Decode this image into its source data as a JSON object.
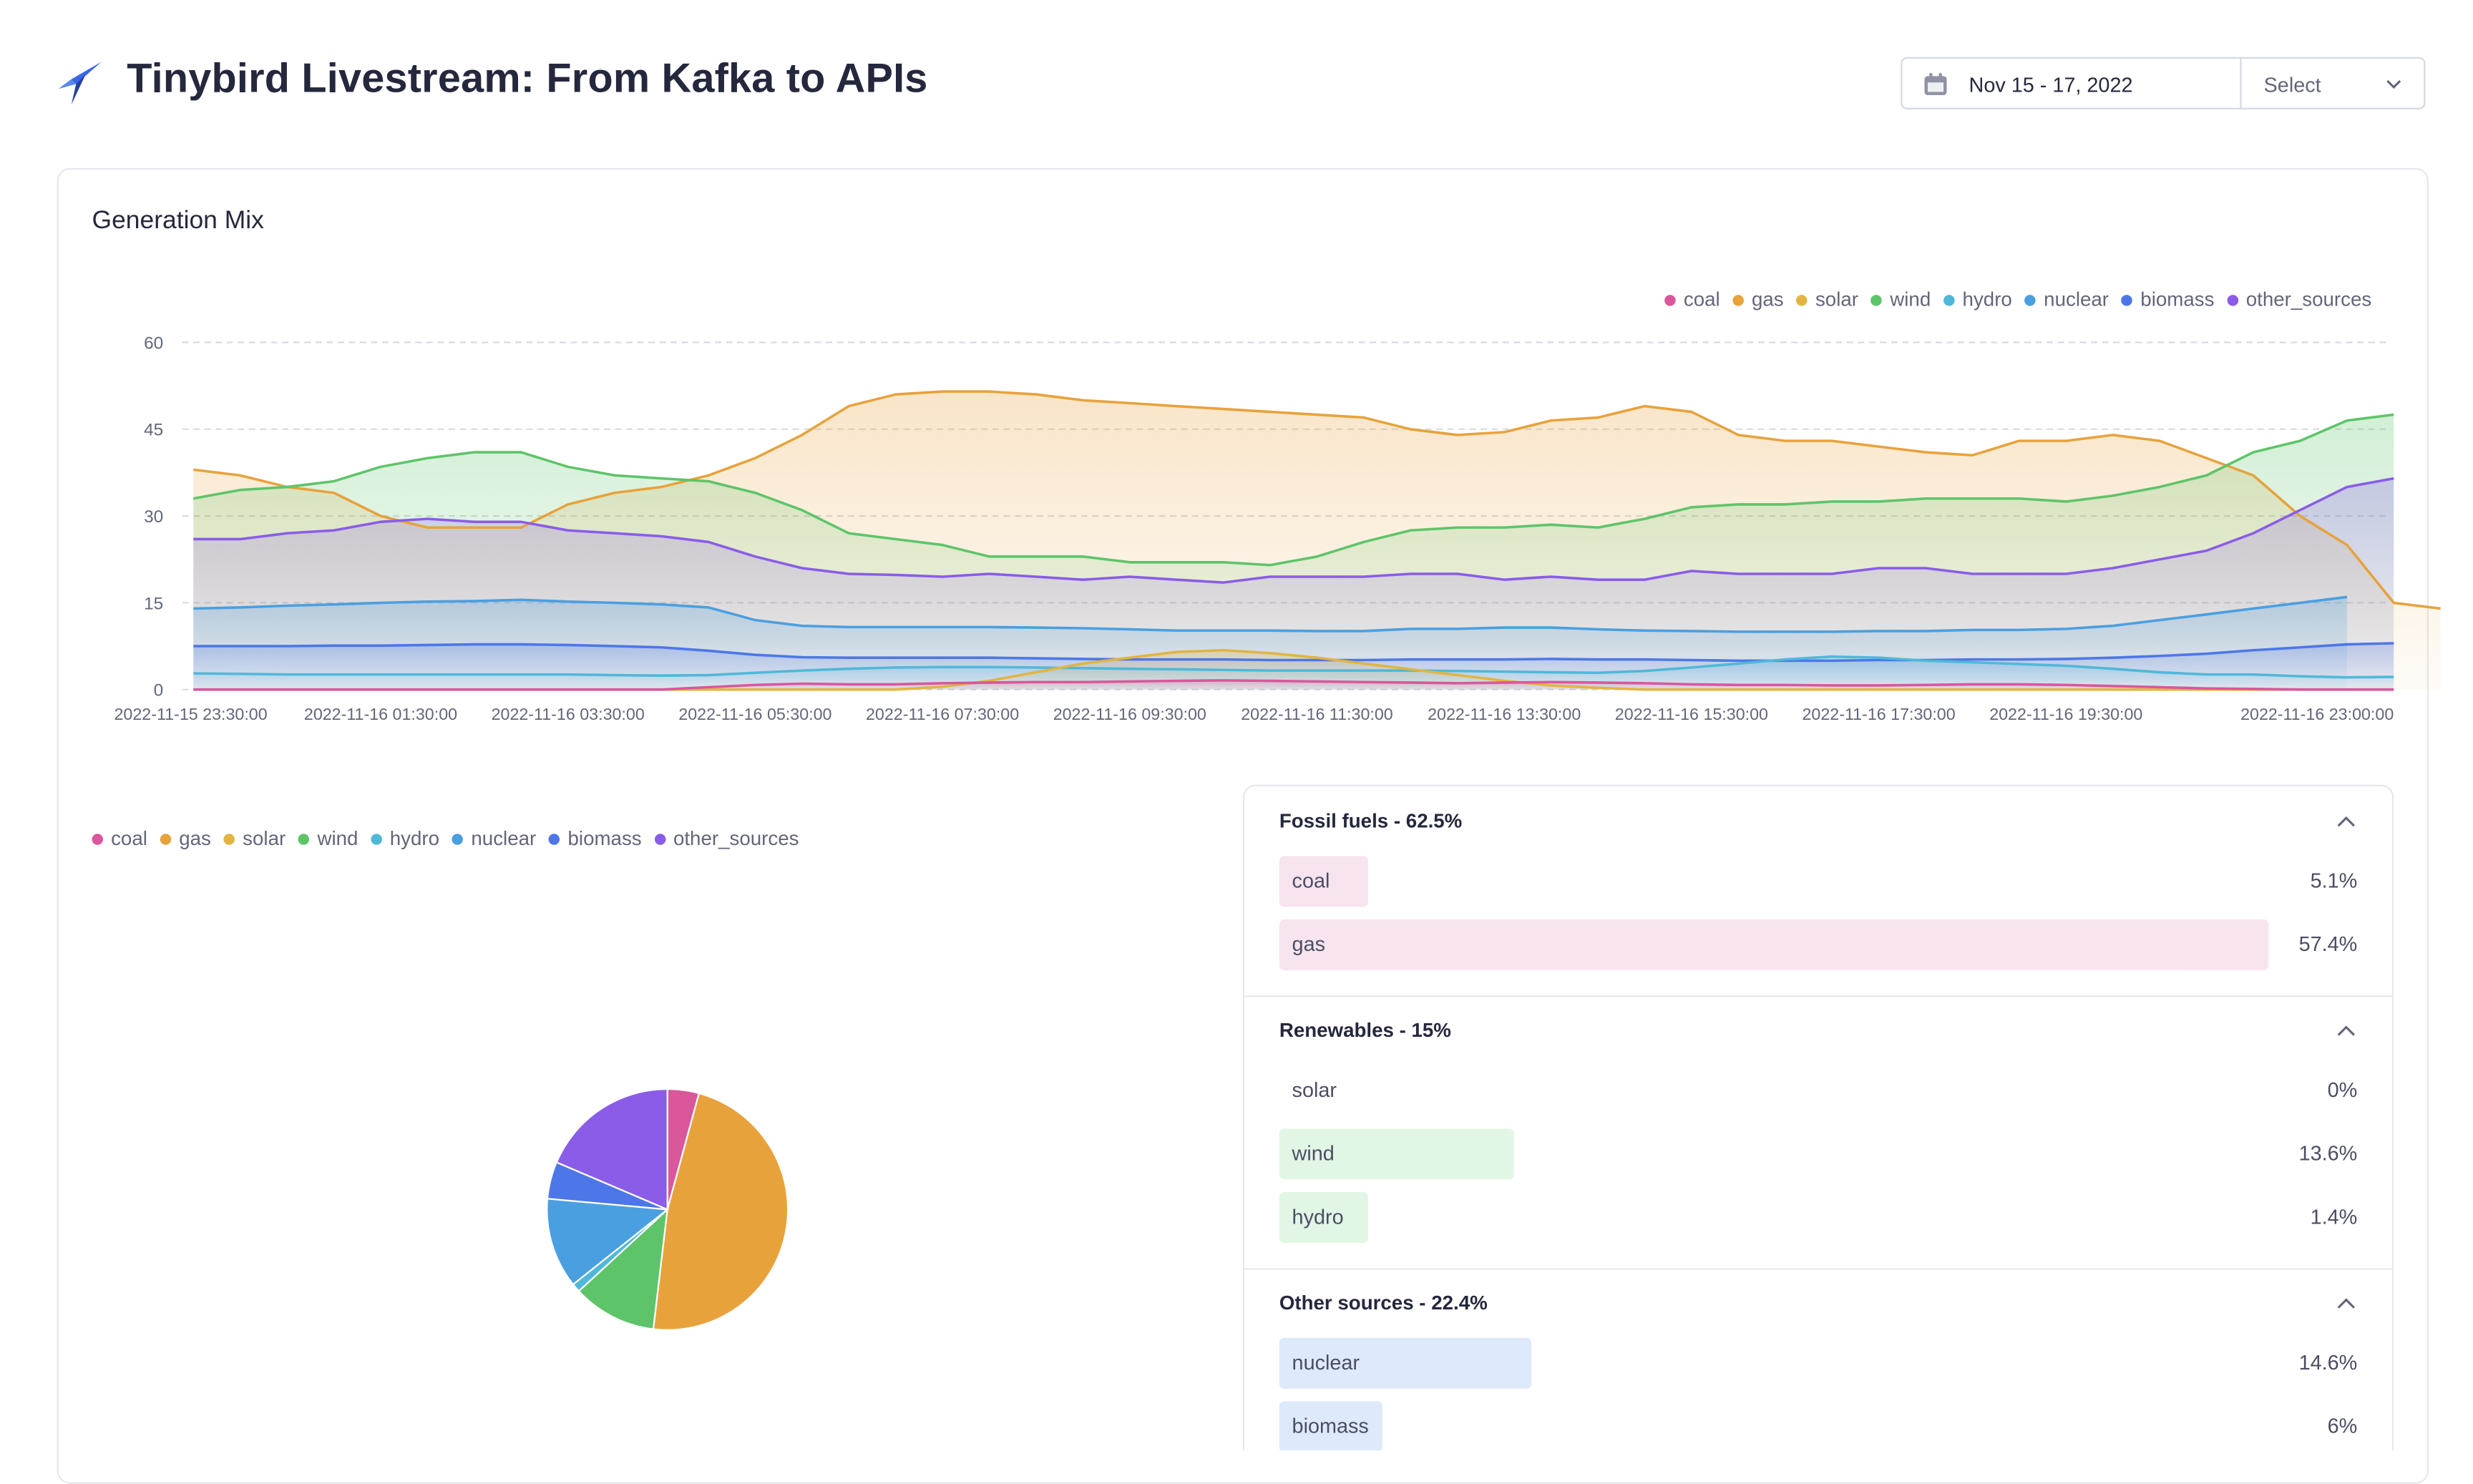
{
  "header": {
    "title": "Tinybird Livestream: From Kafka to APIs",
    "date_range": "Nov 15 - 17, 2022",
    "select_label": "Select"
  },
  "card": {
    "title": "Generation Mix"
  },
  "legend": [
    {
      "name": "coal",
      "color": "#d9579a"
    },
    {
      "name": "gas",
      "color": "#e8a23b"
    },
    {
      "name": "solar",
      "color": "#e2b441"
    },
    {
      "name": "wind",
      "color": "#5ec46a"
    },
    {
      "name": "hydro",
      "color": "#4fb8d9"
    },
    {
      "name": "nuclear",
      "color": "#4a9fe0"
    },
    {
      "name": "biomass",
      "color": "#4d77e8"
    },
    {
      "name": "other_sources",
      "color": "#8a5ce8"
    }
  ],
  "chart_data": [
    {
      "type": "area",
      "ylim": [
        0,
        60
      ],
      "yticks": [
        0,
        15,
        30,
        45,
        60
      ],
      "grid": "horizontal dashed",
      "legend_position": "top-right",
      "x_tick_labels": [
        "2022-11-15 23:30:00",
        "2022-11-16 01:30:00",
        "2022-11-16 03:30:00",
        "2022-11-16 05:30:00",
        "2022-11-16 07:30:00",
        "2022-11-16 09:30:00",
        "2022-11-16 11:30:00",
        "2022-11-16 13:30:00",
        "2022-11-16 15:30:00",
        "2022-11-16 17:30:00",
        "2022-11-16 19:30:00",
        "2022-11-16 23:00:00"
      ],
      "x_tick_index": [
        0,
        4,
        8,
        12,
        16,
        20,
        24,
        28,
        32,
        36,
        40,
        47
      ],
      "series": [
        {
          "name": "gas",
          "color": "#e8a23b",
          "values": [
            38,
            37,
            35,
            34,
            30,
            28,
            28,
            28,
            32,
            34,
            35,
            37,
            40,
            44,
            49,
            51,
            51.5,
            51.5,
            51,
            50,
            49.5,
            49,
            48.5,
            48,
            47.5,
            47,
            45,
            44,
            44.5,
            46.5,
            47,
            49,
            48,
            44,
            43,
            43,
            42,
            41,
            40.5,
            43,
            43,
            44,
            43,
            40,
            37,
            30,
            25,
            15,
            14
          ]
        },
        {
          "name": "wind",
          "color": "#5ec46a",
          "values": [
            33,
            34.5,
            35,
            36,
            38.5,
            40,
            41,
            41,
            38.5,
            37,
            36.5,
            36,
            34,
            31,
            27,
            26,
            25,
            23,
            23,
            23,
            22,
            22,
            22,
            21.5,
            23,
            25.5,
            27.5,
            28,
            28,
            28.5,
            28,
            29.5,
            31.5,
            32,
            32,
            32.5,
            32.5,
            33,
            33,
            33,
            32.5,
            33.5,
            35,
            37,
            41,
            43,
            46.5,
            47.5
          ]
        },
        {
          "name": "other_sources",
          "color": "#8a5ce8",
          "values": [
            26,
            26,
            27,
            27.5,
            29,
            29.5,
            29,
            29,
            27.5,
            27,
            26.5,
            25.5,
            23,
            21,
            20,
            19.8,
            19.5,
            20,
            19.5,
            19,
            19.5,
            19,
            18.5,
            19.5,
            19.5,
            19.5,
            20,
            20,
            19,
            19.5,
            19,
            19,
            20.5,
            20,
            20,
            20,
            21,
            21,
            20,
            20,
            20,
            21,
            22.5,
            24,
            27,
            31,
            35,
            36.5
          ]
        },
        {
          "name": "nuclear",
          "color": "#4a9fe0",
          "values": [
            14,
            14.2,
            14.5,
            14.7,
            15,
            15.2,
            15.3,
            15.5,
            15.2,
            15,
            14.7,
            14.2,
            12,
            11,
            10.8,
            10.8,
            10.8,
            10.8,
            10.7,
            10.6,
            10.4,
            10.2,
            10.2,
            10.2,
            10.1,
            10.1,
            10.5,
            10.5,
            10.7,
            10.7,
            10.4,
            10.2,
            10.1,
            10,
            10,
            10,
            10.1,
            10.1,
            10.3,
            10.3,
            10.5,
            11,
            12,
            13,
            14,
            15,
            16
          ]
        },
        {
          "name": "biomass",
          "color": "#4d77e8",
          "values": [
            7.5,
            7.5,
            7.5,
            7.6,
            7.6,
            7.7,
            7.8,
            7.8,
            7.7,
            7.5,
            7.3,
            6.7,
            6,
            5.6,
            5.5,
            5.5,
            5.5,
            5.5,
            5.4,
            5.3,
            5.2,
            5.2,
            5.2,
            5.1,
            5.1,
            5.1,
            5.2,
            5.2,
            5.2,
            5.3,
            5.2,
            5.2,
            5.1,
            5,
            5,
            5,
            5.1,
            5.1,
            5.2,
            5.2,
            5.3,
            5.5,
            5.8,
            6.2,
            6.8,
            7.3,
            7.8,
            8
          ]
        },
        {
          "name": "hydro",
          "color": "#4fb8d9",
          "values": [
            2.8,
            2.7,
            2.6,
            2.6,
            2.6,
            2.6,
            2.6,
            2.6,
            2.6,
            2.5,
            2.4,
            2.5,
            2.9,
            3.3,
            3.6,
            3.8,
            3.9,
            3.9,
            3.8,
            3.7,
            3.6,
            3.5,
            3.4,
            3.3,
            3.3,
            3.3,
            3.3,
            3.2,
            3.1,
            3,
            2.9,
            3.2,
            3.8,
            4.5,
            5.2,
            5.7,
            5.5,
            5,
            4.7,
            4.4,
            4.1,
            3.6,
            3,
            2.6,
            2.6,
            2.3,
            2.1,
            2.2
          ]
        },
        {
          "name": "solar",
          "color": "#e2b441",
          "values": [
            0,
            0,
            0,
            0,
            0,
            0,
            0,
            0,
            0,
            0,
            0,
            0,
            0,
            0,
            0,
            0,
            0.5,
            1.5,
            3,
            4.5,
            5.5,
            6.5,
            6.8,
            6.3,
            5.5,
            4.5,
            3.5,
            2.5,
            1.5,
            0.7,
            0.3,
            0,
            0,
            0,
            0,
            0,
            0,
            0,
            0,
            0,
            0,
            0,
            0,
            0,
            0,
            0,
            0,
            0
          ]
        },
        {
          "name": "coal",
          "color": "#d9579a",
          "values": [
            0,
            0,
            0,
            0,
            0,
            0,
            0,
            0,
            0,
            0,
            0,
            0.4,
            0.8,
            1,
            0.9,
            0.9,
            1.1,
            1.2,
            1.3,
            1.3,
            1.4,
            1.5,
            1.6,
            1.5,
            1.4,
            1.3,
            1.2,
            1.1,
            1.2,
            1.3,
            1.2,
            1.1,
            0.9,
            0.8,
            0.8,
            0.7,
            0.7,
            0.8,
            0.9,
            0.9,
            0.8,
            0.6,
            0.4,
            0.2,
            0.1,
            0,
            0,
            0
          ]
        }
      ]
    },
    {
      "type": "pie",
      "legend_position": "top-left",
      "slices": [
        {
          "name": "coal",
          "value": 5.1,
          "color": "#d9579a"
        },
        {
          "name": "gas",
          "value": 57.4,
          "color": "#e8a23b"
        },
        {
          "name": "solar",
          "value": 0,
          "color": "#e2b441"
        },
        {
          "name": "wind",
          "value": 13.6,
          "color": "#5ec46a"
        },
        {
          "name": "hydro",
          "value": 1.4,
          "color": "#4fb8d9"
        },
        {
          "name": "nuclear",
          "value": 14.6,
          "color": "#4a9fe0"
        },
        {
          "name": "biomass",
          "value": 6,
          "color": "#4d77e8"
        },
        {
          "name": "other_sources",
          "value": 22.4,
          "color": "#8a5ce8"
        }
      ]
    }
  ],
  "breakdown": {
    "groups": [
      {
        "title": "Fossil fuels - 62.5%",
        "bar_color": "#f7e4ef",
        "rows": [
          {
            "label": "coal",
            "pct_text": "5.1%",
            "value": 5.1
          },
          {
            "label": "gas",
            "pct_text": "57.4%",
            "value": 57.4
          }
        ]
      },
      {
        "title": "Renewables - 15%",
        "bar_color": "#e2f6e6",
        "rows": [
          {
            "label": "solar",
            "pct_text": "0%",
            "value": 0
          },
          {
            "label": "wind",
            "pct_text": "13.6%",
            "value": 13.6
          },
          {
            "label": "hydro",
            "pct_text": "1.4%",
            "value": 1.4
          }
        ]
      },
      {
        "title": "Other sources - 22.4%",
        "bar_color": "#dee9fb",
        "rows": [
          {
            "label": "nuclear",
            "pct_text": "14.6%",
            "value": 14.6
          },
          {
            "label": "biomass",
            "pct_text": "6%",
            "value": 6
          }
        ]
      }
    ]
  }
}
